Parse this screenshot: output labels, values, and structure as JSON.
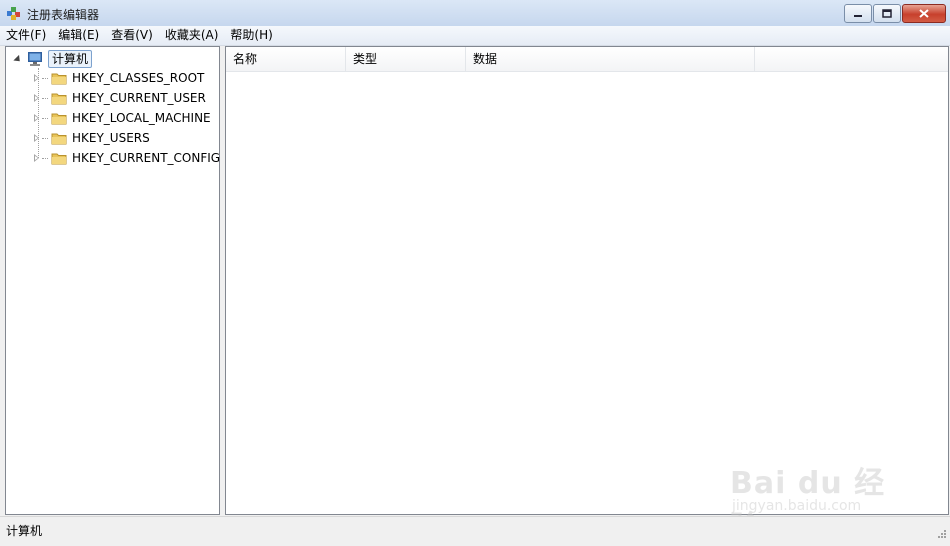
{
  "window": {
    "title": "注册表编辑器"
  },
  "menu": [
    {
      "label": "文件(F)"
    },
    {
      "label": "编辑(E)"
    },
    {
      "label": "查看(V)"
    },
    {
      "label": "收藏夹(A)"
    },
    {
      "label": "帮助(H)"
    }
  ],
  "tree": {
    "root_label": "计算机",
    "nodes": [
      {
        "label": "HKEY_CLASSES_ROOT"
      },
      {
        "label": "HKEY_CURRENT_USER"
      },
      {
        "label": "HKEY_LOCAL_MACHINE"
      },
      {
        "label": "HKEY_USERS"
      },
      {
        "label": "HKEY_CURRENT_CONFIG"
      }
    ]
  },
  "list": {
    "columns": [
      {
        "label": "名称"
      },
      {
        "label": "类型"
      },
      {
        "label": "数据"
      },
      {
        "label": ""
      }
    ]
  },
  "status": {
    "path": "计算机"
  },
  "watermark": {
    "main": "Bai du 经验",
    "sub": "jingyan.baidu.com"
  },
  "colors": {
    "title_gradient_top": "#dbe7f6",
    "close_button": "#c7402c",
    "selected_bg": "#eaf2fb",
    "folder": "#e8c45a"
  }
}
